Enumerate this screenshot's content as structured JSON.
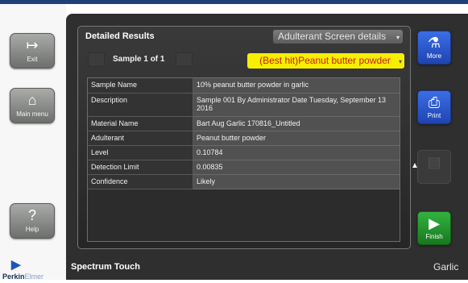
{
  "left_nav": {
    "exit_label": "Exit",
    "main_menu_label": "Main menu",
    "help_label": "Help"
  },
  "icons": {
    "exit": "exit-door-icon",
    "home": "home-icon",
    "help": "question-icon",
    "more": "flask-icon",
    "print": "printer-icon",
    "finish": "play-arrow-icon",
    "disabled_action": "document-icon"
  },
  "logo": {
    "brand_dark": "Perkin",
    "brand_light": "Elmer"
  },
  "results": {
    "title": "Detailed Results",
    "mode": "Adulterant Screen details",
    "sample_counter": "Sample 1 of 1",
    "best_hit": "(Best hit)Peanut butter powder",
    "rows": [
      {
        "key": "Sample Name",
        "value": "10% peanut butter powder in garlic"
      },
      {
        "key": "Description",
        "value": "Sample 001 By Administrator Date Tuesday, September 13 2016"
      },
      {
        "key": "Material Name",
        "value": "Bart Aug Garlic 170816_Untitled"
      },
      {
        "key": "Adulterant",
        "value": "Peanut butter powder"
      },
      {
        "key": "Level",
        "value": "0.10784"
      },
      {
        "key": "Detection Limit",
        "value": "0.00835"
      },
      {
        "key": "Confidence",
        "value": "Likely"
      }
    ]
  },
  "right_nav": {
    "more_label": "More",
    "print_label": "Print",
    "finish_label": "Finish"
  },
  "footer": {
    "app_name": "Spectrum Touch",
    "material": "Garlic"
  },
  "colors": {
    "accent_blue": "#2a56cc",
    "finish_green": "#24a030",
    "best_hit_yellow": "#f8ef00",
    "best_hit_text": "#c41a1a"
  }
}
